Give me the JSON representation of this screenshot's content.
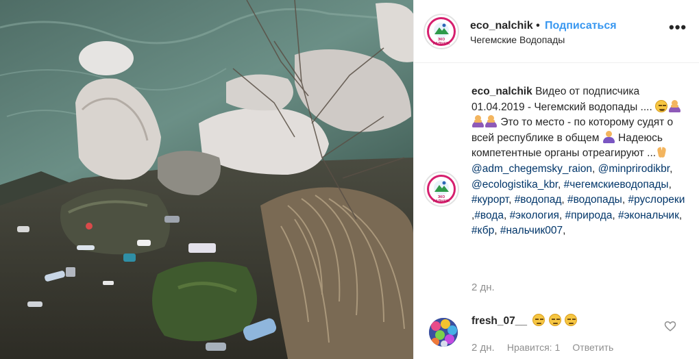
{
  "post": {
    "username": "eco_nalchik",
    "separator": "•",
    "follow_label": "Подписаться",
    "location": "Чегемские Водопады",
    "more_label": "•••",
    "avatar_text": "ЭКО НАЛЬЧИК"
  },
  "caption": {
    "username": "eco_nalchik",
    "text_1": "Видео от подписчика 01.04.2019 - Чегемский водопады ....",
    "text_2": "Это то место - по которому судят о всей республике в общем",
    "text_3": "Надеюсь компетентные органы отреагируют ...",
    "mentions": [
      "@adm_chegemsky_raion",
      "@minprirodikbr",
      "@ecologistika_kbr"
    ],
    "hashtags": [
      "#чегемскиеводопады",
      "#курорт",
      "#водопад",
      "#водопады",
      "#руслореки",
      "#вода",
      "#экология",
      "#природа",
      "#экональчик",
      "#кбр",
      "#нальчик007"
    ],
    "separator": ","
  },
  "post_time": "2 дн.",
  "comment": {
    "username": "fresh_07__",
    "emoji": [
      "unamused-face",
      "unamused-face",
      "unamused-face"
    ],
    "time": "2 дн.",
    "likes_label": "Нравится: 1",
    "reply_label": "Ответить"
  },
  "icons": {
    "more": "more-dots-icon",
    "heart": "heart-outline-icon"
  },
  "colors": {
    "link_blue": "#3897f0",
    "mention_blue": "#003569",
    "muted": "#8e8e8e",
    "text": "#262626",
    "avatar_ring": "#d61f6e"
  }
}
